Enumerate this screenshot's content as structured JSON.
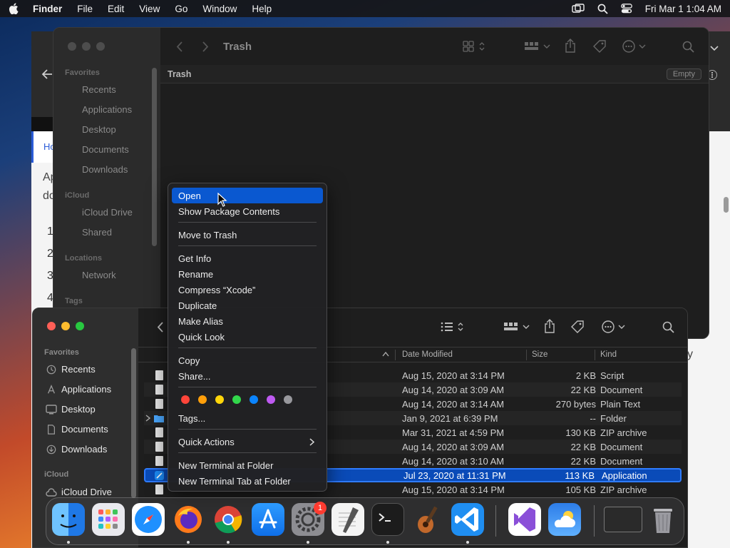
{
  "menubar": {
    "items": [
      "Finder",
      "File",
      "Edit",
      "View",
      "Go",
      "Window",
      "Help"
    ],
    "clock": "Fri Mar 1  1:04 AM",
    "icons": [
      "apple-icon",
      "screen-mirroring-icon",
      "search-icon",
      "control-center-icon"
    ]
  },
  "trash_window": {
    "title": "Trash",
    "path_label": "Trash",
    "empty_button": "Empty",
    "sidebar": {
      "favorites_heading": "Favorites",
      "favorites": [
        "Recents",
        "Applications",
        "Desktop",
        "Documents",
        "Downloads"
      ],
      "icloud_heading": "iCloud",
      "icloud": [
        "iCloud Drive",
        "Shared"
      ],
      "locations_heading": "Locations",
      "locations": [
        "Network"
      ],
      "tags_heading": "Tags"
    }
  },
  "list_window": {
    "sidebar": {
      "favorites_heading": "Favorites",
      "favorites": [
        "Recents",
        "Applications",
        "Desktop",
        "Documents",
        "Downloads"
      ],
      "icloud_heading": "iCloud",
      "icloud": [
        "iCloud Drive"
      ]
    },
    "columns": {
      "date": "Date Modified",
      "size": "Size",
      "kind": "Kind"
    },
    "rows": [
      {
        "date": "Aug 15, 2020 at 3:14 PM",
        "size": "2 KB",
        "kind": "Script"
      },
      {
        "date": "Aug 14, 2020 at 3:09 AM",
        "size": "22 KB",
        "kind": "Document"
      },
      {
        "date": "Aug 14, 2020 at 3:14 AM",
        "size": "270 bytes",
        "kind": "Plain Text"
      },
      {
        "date": "Jan 9, 2021 at 6:39 PM",
        "size": "--",
        "kind": "Folder"
      },
      {
        "date": "Mar 31, 2021 at 4:59 PM",
        "size": "130 KB",
        "kind": "ZIP archive"
      },
      {
        "date": "Aug 14, 2020 at 3:09 AM",
        "size": "22 KB",
        "kind": "Document"
      },
      {
        "date": "Aug 14, 2020 at 3:10 AM",
        "size": "22 KB",
        "kind": "Document"
      },
      {
        "date": "Jul 23, 2020 at 11:31 PM",
        "size": "113 KB",
        "kind": "Application"
      },
      {
        "date": "Aug 15, 2020 at 3:14 PM",
        "size": "105 KB",
        "kind": "ZIP archive"
      }
    ]
  },
  "context_menu": {
    "open": "Open",
    "show_package": "Show Package Contents",
    "move_to_trash": "Move to Trash",
    "get_info": "Get Info",
    "rename": "Rename",
    "compress": "Compress “Xcode”",
    "duplicate": "Duplicate",
    "make_alias": "Make Alias",
    "quick_look": "Quick Look",
    "copy": "Copy",
    "share": "Share...",
    "tags": "Tags...",
    "quick_actions": "Quick Actions",
    "new_terminal": "New Terminal at Folder",
    "new_terminal_tab": "New Terminal Tab at Folder",
    "tag_colors": [
      "#ff453a",
      "#ff9f0a",
      "#ffd60a",
      "#32d74b",
      "#0a84ff",
      "#bf5af2",
      "#98989d"
    ]
  },
  "dock": {
    "apps": [
      "Finder",
      "Launchpad",
      "Safari",
      "Firefox",
      "Chrome",
      "App Store",
      "System Settings",
      "TextEdit",
      "Terminal",
      "GarageBand",
      "Visual Studio Code",
      "Visual Studio",
      "Weather",
      "Window Preview",
      "Trash"
    ],
    "settings_badge": "1"
  },
  "browser_bg": {
    "tab_text": "Ho",
    "snippets": [
      "Ap",
      "do",
      "1",
      "2",
      "3",
      "4",
      "y"
    ]
  }
}
